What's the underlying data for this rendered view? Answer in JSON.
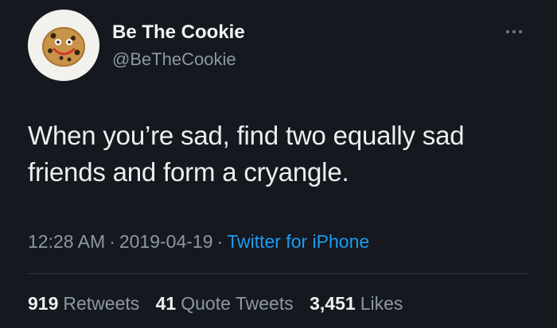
{
  "author": {
    "display_name": "Be The Cookie",
    "handle": "@BeTheCookie",
    "avatar_icon": "smiling-cookie-icon"
  },
  "tweet": {
    "text": "When you’re sad, find two equally sad friends and form a cryangle.",
    "time": "12:28 AM",
    "separator": "·",
    "date": "2019-04-19",
    "source": "Twitter for iPhone"
  },
  "stats": {
    "retweets_count": "919",
    "retweets_label": "Retweets",
    "quotes_count": "41",
    "quotes_label": "Quote Tweets",
    "likes_count": "3,451",
    "likes_label": "Likes"
  },
  "colors": {
    "background": "#15181e",
    "link": "#1d9bf0",
    "secondary_text": "#8b98a5"
  }
}
